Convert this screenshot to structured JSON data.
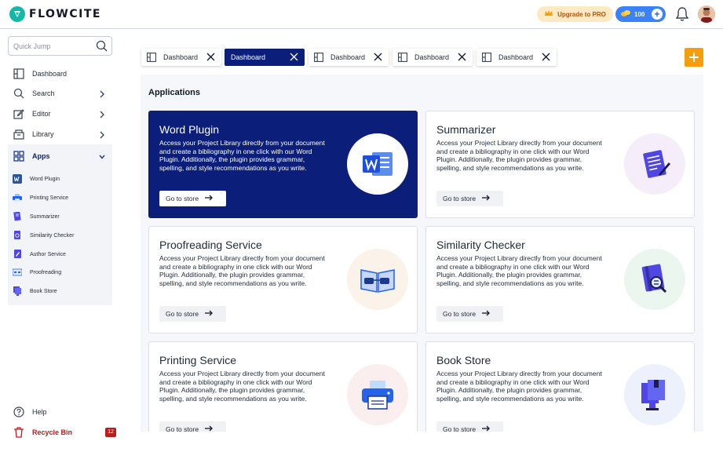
{
  "brand": {
    "name": "FLOWCITE",
    "accent": "#0b1f7a",
    "teal": "#14b8a6"
  },
  "header": {
    "upgrade_label": "Upgrade to PRO",
    "credits_value": "100",
    "notifications_icon": "bell-icon",
    "avatar_icon": "user-avatar"
  },
  "sidebar": {
    "quick_jump_placeholder": "Quick Jump",
    "items": [
      {
        "label": "Dashboard",
        "icon": "layout-icon"
      },
      {
        "label": "Search",
        "icon": "search-icon"
      },
      {
        "label": "Editor",
        "icon": "edit-icon"
      },
      {
        "label": "Library",
        "icon": "library-icon"
      },
      {
        "label": "Apps",
        "icon": "grid-icon"
      }
    ],
    "apps": [
      {
        "label": "Word Plugin",
        "icon": "word-icon"
      },
      {
        "label": "Printing Service",
        "icon": "printer-icon"
      },
      {
        "label": "Summarizer",
        "icon": "summarizer-icon"
      },
      {
        "label": "Similarity Checker",
        "icon": "similarity-icon"
      },
      {
        "label": "Author Service",
        "icon": "author-icon"
      },
      {
        "label": "Proofreading",
        "icon": "proofreading-icon"
      },
      {
        "label": "Book Store",
        "icon": "bookstore-icon"
      }
    ],
    "help_label": "Help",
    "recycle_label": "Recycle Bin",
    "recycle_count": "12"
  },
  "tabs": [
    {
      "label": "Dashboard",
      "active": false
    },
    {
      "label": "Dashboard",
      "active": true
    },
    {
      "label": "Dashboard",
      "active": false
    },
    {
      "label": "Dashboard",
      "active": false
    },
    {
      "label": "Dashboard",
      "active": false
    }
  ],
  "main": {
    "title": "Applications",
    "store_label": "Go to store",
    "cards": [
      {
        "title": "Word Plugin",
        "desc": "Access your Project Library directly from your document and create a bibliography in one click with our Word Plugin. Additionally, the plugin provides grammar, spelling, and style recommendations as you write.",
        "icon": "word-icon"
      },
      {
        "title": "Summarizer",
        "desc": "Access your Project Library directly from your document and create a bibliography in one click with our Word Plugin. Additionally, the plugin provides grammar, spelling, and style recommendations as you write.",
        "icon": "summarizer-icon"
      },
      {
        "title": "Proofreading Service",
        "desc": "Access your Project Library directly from your document and create a bibliography in one click with our Word Plugin. Additionally, the plugin provides grammar, spelling, and style recommendations as you write.",
        "icon": "proofreading-icon"
      },
      {
        "title": "Similarity Checker",
        "desc": "Access your Project Library directly from your document and create a bibliography in one click with our Word Plugin. Additionally, the plugin provides grammar, spelling, and style recommendations as you write.",
        "icon": "similarity-icon"
      },
      {
        "title": "Printing Service",
        "desc": "Access your Project Library directly from your document and create a bibliography in one click with our Word Plugin. Additionally, the plugin provides grammar, spelling, and style recommendations as you write.",
        "icon": "printer-icon"
      },
      {
        "title": "Book Store",
        "desc": "Access your Project Library directly from your document and create a bibliography in one click with our Word Plugin. Additionally, the plugin provides grammar, spelling, and style recommendations as you write.",
        "icon": "bookstore-icon"
      }
    ]
  }
}
